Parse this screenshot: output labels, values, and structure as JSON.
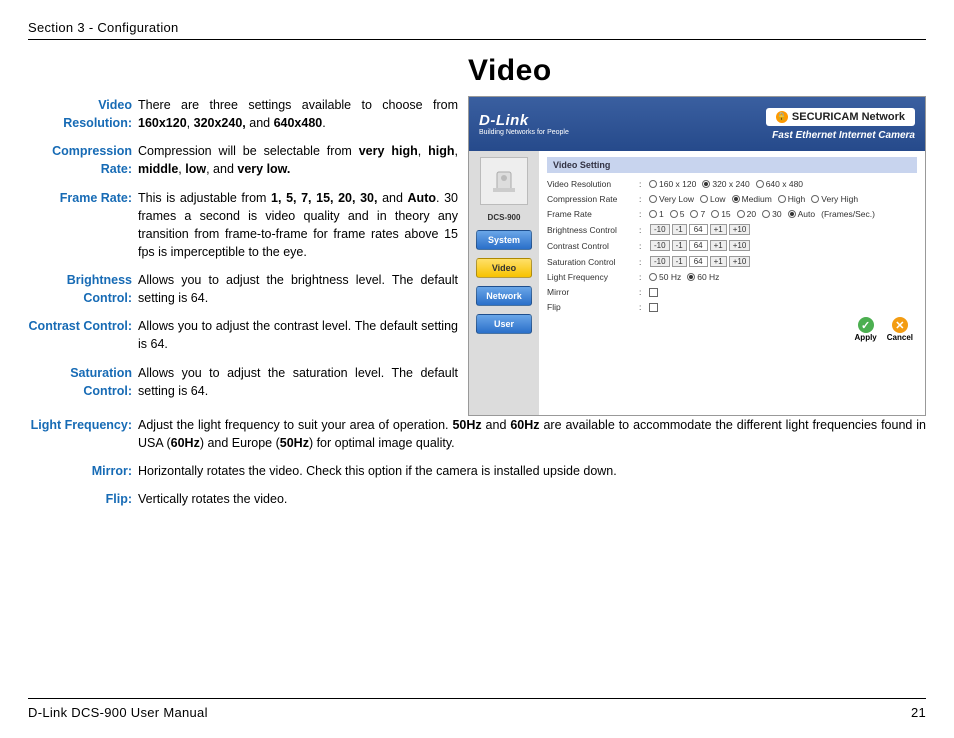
{
  "header": "Section 3 - Configuration",
  "title": "Video",
  "defs": [
    {
      "label": "Video Resolution:",
      "text_parts": [
        "There are three settings available to choose from ",
        "160x120",
        ", ",
        "320x240,",
        " and ",
        "640x480",
        "."
      ]
    },
    {
      "label": "Compression Rate:",
      "text_parts": [
        "Compression will be selectable from ",
        "very high",
        ", ",
        "high",
        ", ",
        "middle",
        ", ",
        "low",
        ", and ",
        "very low."
      ]
    },
    {
      "label": "Frame Rate:",
      "text_parts": [
        "This is adjustable from ",
        "1, 5, 7, 15, 20, 30,",
        " and ",
        "Auto",
        ". 30 frames a second is video quality and in theory any transition from frame-to-frame for frame rates above 15 fps is imperceptible to the eye."
      ]
    },
    {
      "label": "Brightness Control:",
      "text_parts": [
        "Allows you to adjust the brightness level. The default setting is 64."
      ]
    },
    {
      "label": "Contrast Control:",
      "text_parts": [
        "Allows you to adjust the contrast level. The default setting is 64."
      ]
    },
    {
      "label": "Saturation Control:",
      "text_parts": [
        "Allows you to adjust the saturation level. The default setting is 64."
      ]
    }
  ],
  "wide_defs": [
    {
      "label": "Light Frequency:",
      "text_parts": [
        "Adjust the light frequency to suit your area of operation. ",
        "50Hz",
        " and ",
        "60Hz",
        " are available to accommodate the different light frequencies found in USA (",
        "60Hz",
        ") and Europe (",
        "50Hz",
        ") for optimal image quality."
      ]
    },
    {
      "label": "Mirror:",
      "text_parts": [
        "Horizontally rotates the video. Check this option if the camera is installed upside down."
      ]
    },
    {
      "label": "Flip:",
      "text_parts": [
        "Vertically rotates the video."
      ]
    }
  ],
  "screenshot": {
    "brand": "D-Link",
    "brand_tag": "Building Networks for People",
    "securicam_prefix": "SECURI",
    "securicam_suffix": "CAM",
    "securicam_net": " Network",
    "subtitle": "Fast Ethernet Internet Camera",
    "model": "DCS-900",
    "nav": {
      "system": "System",
      "video": "Video",
      "network": "Network",
      "user": "User"
    },
    "panel_title": "Video Setting",
    "rows": {
      "video_res_label": "Video Resolution",
      "video_res_opts": [
        "160 x 120",
        "320 x 240",
        "640 x 480"
      ],
      "video_res_selected": 1,
      "comp_label": "Compression Rate",
      "comp_opts": [
        "Very Low",
        "Low",
        "Medium",
        "High",
        "Very High"
      ],
      "comp_selected": 2,
      "frame_label": "Frame Rate",
      "frame_opts": [
        "1",
        "5",
        "7",
        "15",
        "20",
        "30",
        "Auto"
      ],
      "frame_suffix": "(Frames/Sec.)",
      "frame_selected": 6,
      "bright_label": "Brightness Control",
      "contrast_label": "Contrast Control",
      "sat_label": "Saturation Control",
      "stepper_btns": [
        "-10",
        "-1",
        "+1",
        "+10"
      ],
      "stepper_val": "64",
      "light_label": "Light Frequency",
      "light_opts": [
        "50 Hz",
        "60 Hz"
      ],
      "light_selected": 1,
      "mirror_label": "Mirror",
      "flip_label": "Flip"
    },
    "apply": "Apply",
    "cancel": "Cancel"
  },
  "footer_left": "D-Link DCS-900 User Manual",
  "footer_right": "21"
}
